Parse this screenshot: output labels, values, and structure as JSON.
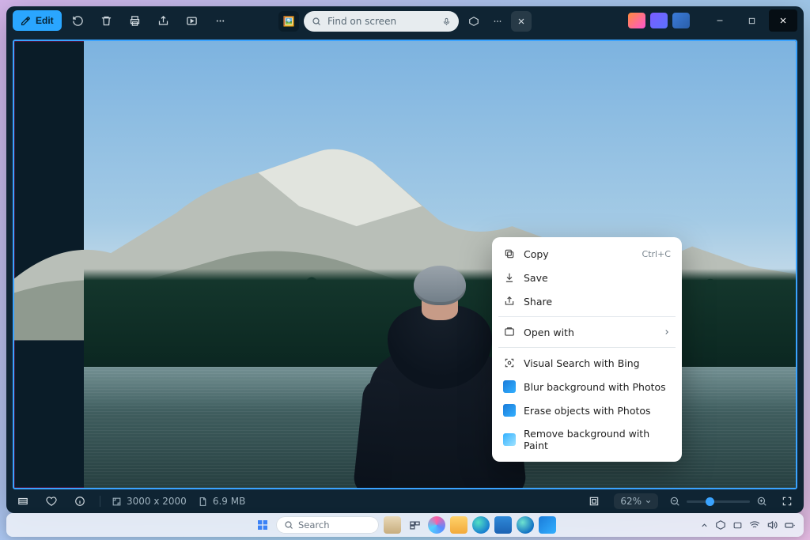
{
  "toolbar": {
    "edit_label": "Edit"
  },
  "search": {
    "placeholder": "Find on screen"
  },
  "context_menu": {
    "items": [
      {
        "label": "Copy",
        "shortcut": "Ctrl+C",
        "icon": "copy"
      },
      {
        "label": "Save",
        "icon": "download"
      },
      {
        "label": "Share",
        "icon": "share"
      },
      {
        "label": "Open with",
        "icon": "open-with",
        "submenu": true
      },
      {
        "label": "Visual Search with Bing",
        "icon": "visual-search"
      },
      {
        "label": "Blur background with Photos",
        "icon": "photos-app"
      },
      {
        "label": "Erase objects with Photos",
        "icon": "photos-app"
      },
      {
        "label": "Remove background with Paint",
        "icon": "paint-app"
      }
    ]
  },
  "status": {
    "dimensions": "3000 x 2000",
    "filesize": "6.9 MB",
    "zoom": "62%"
  },
  "taskbar": {
    "search_label": "Search"
  }
}
